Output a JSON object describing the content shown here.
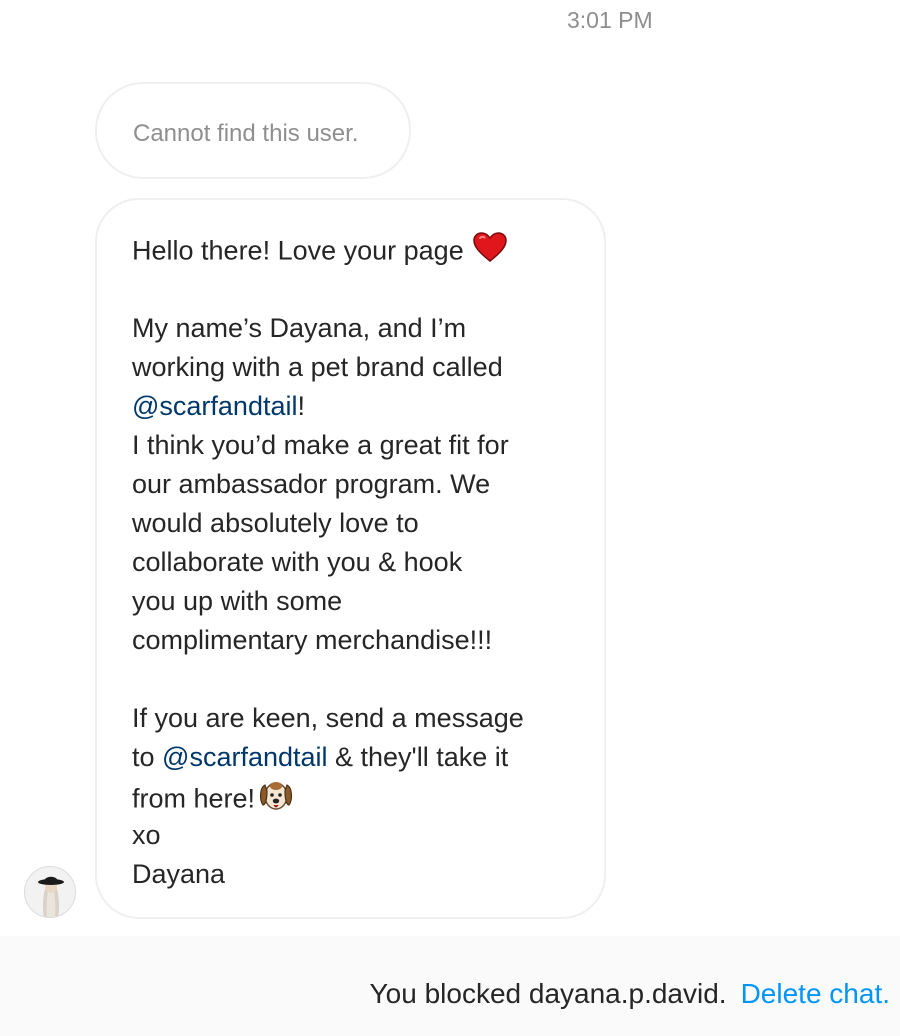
{
  "thread": {
    "timestamp": "3:01 PM"
  },
  "system_message": {
    "text": "Cannot find this user."
  },
  "message": {
    "line1": "Hello there! Love your page",
    "emoji1": "red-heart-emoji",
    "line3": "My name’s Dayana, and I’m",
    "line4": "working with a pet brand called",
    "mention1": "@scarfandtail",
    "line5_suffix": "!",
    "line6": "I think you’d make a great fit for",
    "line7": "our ambassador program. We",
    "line8": "would absolutely love to",
    "line9": "collaborate with you & hook",
    "line10": "you up with some",
    "line11": "complimentary merchandise!!!",
    "line13": "If you are keen, send a message",
    "line14_prefix": "to ",
    "mention2": "@scarfandtail",
    "line14_suffix": " & they'll take it",
    "line15": "from here!",
    "emoji2": "dog-face-emoji",
    "line16": "xo",
    "line17": "Dayana",
    "mention_color": "#00376b"
  },
  "sender": {
    "avatar_icon": "profile-photo"
  },
  "footer": {
    "blocked_text": "You blocked dayana.p.david.",
    "delete_label": "Delete chat.",
    "link_color": "#0095f6"
  }
}
